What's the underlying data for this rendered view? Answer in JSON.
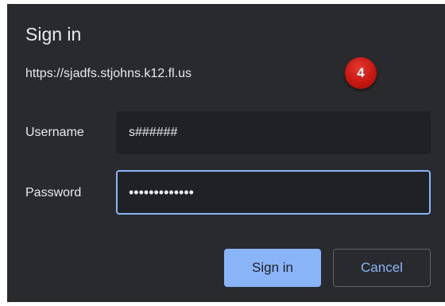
{
  "dialog": {
    "title": "Sign in",
    "origin": "https://sjadfs.stjohns.k12.fl.us",
    "badge": "4"
  },
  "form": {
    "username_label": "Username",
    "username_value": "s######",
    "password_label": "Password",
    "password_value": "•••••••••••••"
  },
  "buttons": {
    "sign_in": "Sign in",
    "cancel": "Cancel"
  },
  "colors": {
    "dialog_bg": "#292a2d",
    "field_bg": "#202124",
    "accent": "#8ab4f8",
    "badge": "#c5170f"
  }
}
